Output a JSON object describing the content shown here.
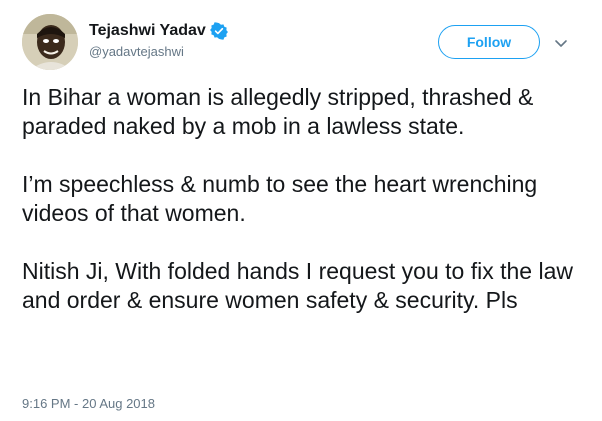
{
  "author": {
    "display_name": "Tejashwi Yadav",
    "handle": "@yadavtejashwi",
    "verified": true
  },
  "actions": {
    "follow_label": "Follow"
  },
  "tweet": {
    "paragraphs": [
      "In Bihar a woman is allegedly stripped, thrashed & paraded naked by a mob in a lawless state.",
      "I’m speechless & numb to see the heart wrenching videos of that women.",
      "Nitish Ji, With folded hands I request you to fix the law and order & ensure women safety & security. Pls"
    ],
    "timestamp": "9:16 PM - 20 Aug 2018"
  },
  "icons": {
    "verified": "verified-badge-icon",
    "menu": "chevron-down-icon"
  },
  "colors": {
    "accent": "#1da1f2",
    "secondary_text": "#657786",
    "primary_text": "#14171a"
  }
}
